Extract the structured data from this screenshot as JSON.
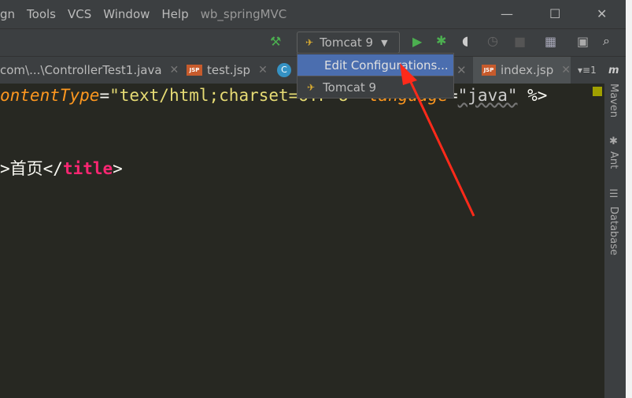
{
  "menu": {
    "items": [
      "gn",
      "Tools",
      "VCS",
      "Window",
      "Help"
    ],
    "project": "wb_springMVC",
    "minimize": "—",
    "maximize": "☐",
    "close": "✕"
  },
  "toolbar": {
    "run_config": "Tomcat 9",
    "icons": [
      "build-hammer-icon",
      "run-icon",
      "debug-icon",
      "coverage-icon",
      "profile-icon",
      "stop-icon",
      "project-structure-icon",
      "terminal-icon",
      "search-icon"
    ]
  },
  "tabs": [
    {
      "label": "com\\...\\ControllerTest1.java"
    },
    {
      "label": "test.jsp"
    },
    {
      "label": "index.jsp"
    }
  ],
  "tab_overflow": "1",
  "dropdown": {
    "items": [
      "Edit Configurations...",
      "Tomcat 9"
    ]
  },
  "editor": {
    "line1": {
      "attr1": "ontentType",
      "eq": "=",
      "val1": "\"text/html;charset=UTF-8\"",
      "attr2": "language",
      "val2": "\"java\"",
      "end": "%>"
    },
    "line2": {
      "open": ">",
      "text": "首页",
      "close": "</",
      "tag": "title",
      "end": ">"
    }
  },
  "right_tools": [
    "Maven",
    "Ant",
    "Database"
  ],
  "colors": {
    "accent": "#4b6eaf",
    "arrow": "#ff2a1a"
  }
}
